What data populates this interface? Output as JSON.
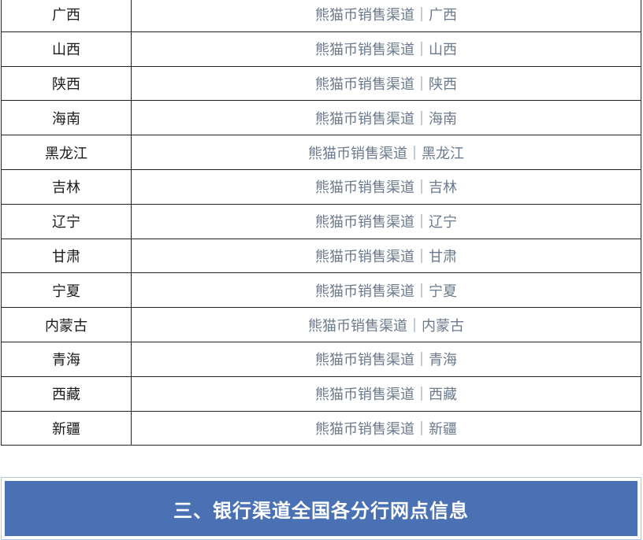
{
  "region_table": {
    "rows": [
      {
        "region": "广西",
        "link": "熊猫币销售渠道｜广西"
      },
      {
        "region": "山西",
        "link": "熊猫币销售渠道｜山西"
      },
      {
        "region": "陕西",
        "link": "熊猫币销售渠道｜陕西"
      },
      {
        "region": "海南",
        "link": "熊猫币销售渠道｜海南"
      },
      {
        "region": "黑龙江",
        "link": "熊猫币销售渠道｜黑龙江"
      },
      {
        "region": "吉林",
        "link": "熊猫币销售渠道｜吉林"
      },
      {
        "region": "辽宁",
        "link": "熊猫币销售渠道｜辽宁"
      },
      {
        "region": "甘肃",
        "link": "熊猫币销售渠道｜甘肃"
      },
      {
        "region": "宁夏",
        "link": "熊猫币销售渠道｜宁夏"
      },
      {
        "region": "内蒙古",
        "link": "熊猫币销售渠道｜内蒙古"
      },
      {
        "region": "青海",
        "link": "熊猫币销售渠道｜青海"
      },
      {
        "region": "西藏",
        "link": "熊猫币销售渠道｜西藏"
      },
      {
        "region": "新疆",
        "link": "熊猫币销售渠道｜新疆"
      }
    ]
  },
  "section_banner": {
    "title": "三、银行渠道全国各分行网点信息",
    "background_color": "#4a71b4",
    "text_color": "#ffffff"
  }
}
